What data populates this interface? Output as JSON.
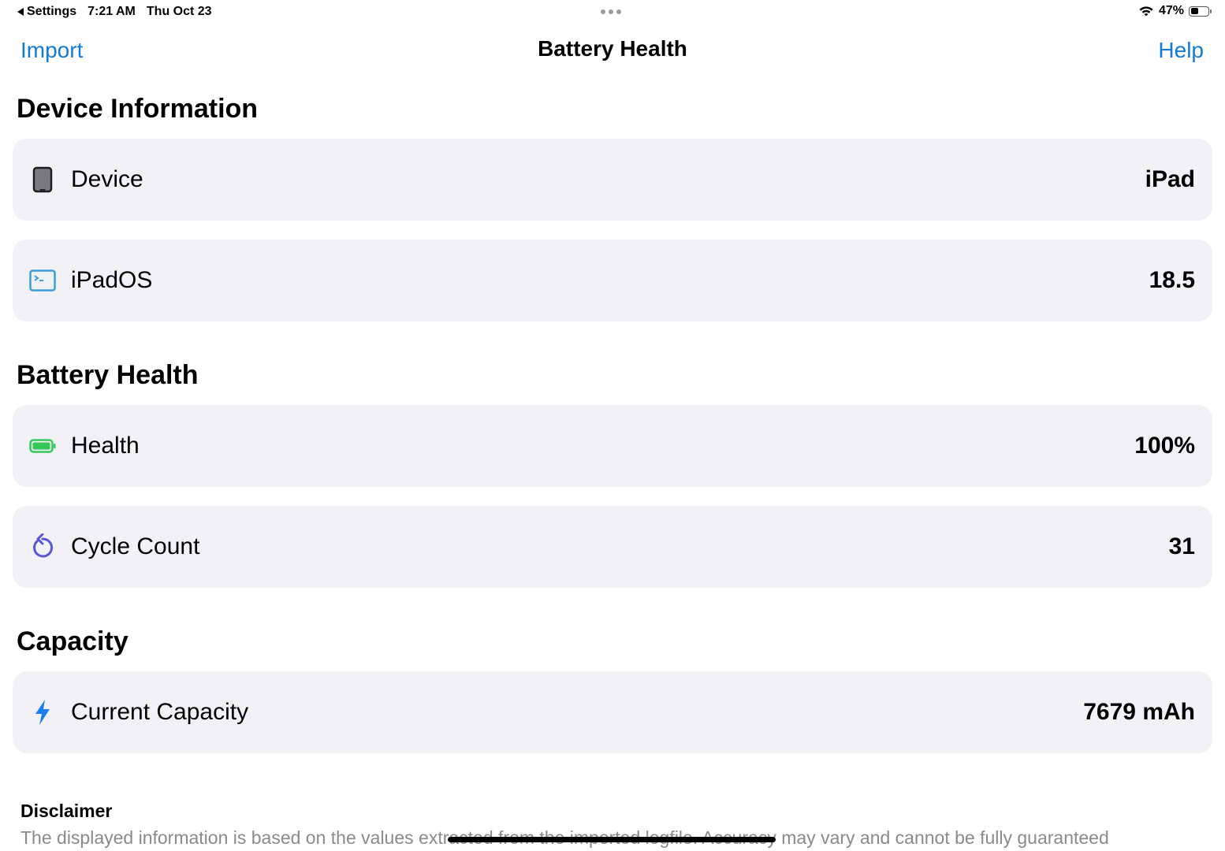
{
  "status_bar": {
    "back_app": "Settings",
    "time": "7:21 AM",
    "date": "Thu Oct 23",
    "battery_percent": "47%",
    "battery_level": 0.47
  },
  "nav": {
    "left_button": "Import",
    "title": "Battery Health",
    "right_button": "Help",
    "accent_color": "#1479d8"
  },
  "sections": {
    "device_info": {
      "title": "Device Information",
      "rows": [
        {
          "icon": "ipad-icon",
          "label": "Device",
          "value": "iPad"
        },
        {
          "icon": "terminal-icon",
          "label": "iPadOS",
          "value": "18.5"
        }
      ]
    },
    "battery_health": {
      "title": "Battery Health",
      "rows": [
        {
          "icon": "battery-full-icon",
          "label": "Health",
          "value": "100%"
        },
        {
          "icon": "cycle-arrow-icon",
          "label": "Cycle Count",
          "value": "31"
        }
      ]
    },
    "capacity": {
      "title": "Capacity",
      "rows": [
        {
          "icon": "bolt-icon",
          "label": "Current Capacity",
          "value": "7679 mAh"
        }
      ]
    }
  },
  "disclaimer": {
    "title": "Disclaimer",
    "text": "The displayed information is based on the values extracted from the imported logfile. Accuracy may vary and cannot be fully guaranteed"
  },
  "colors": {
    "row_background": "#f2f1f6",
    "terminal_icon": "#3aa0d8",
    "battery_icon": "#34c759",
    "cycle_icon": "#5856d6",
    "bolt_icon": "#1a7ef0"
  }
}
